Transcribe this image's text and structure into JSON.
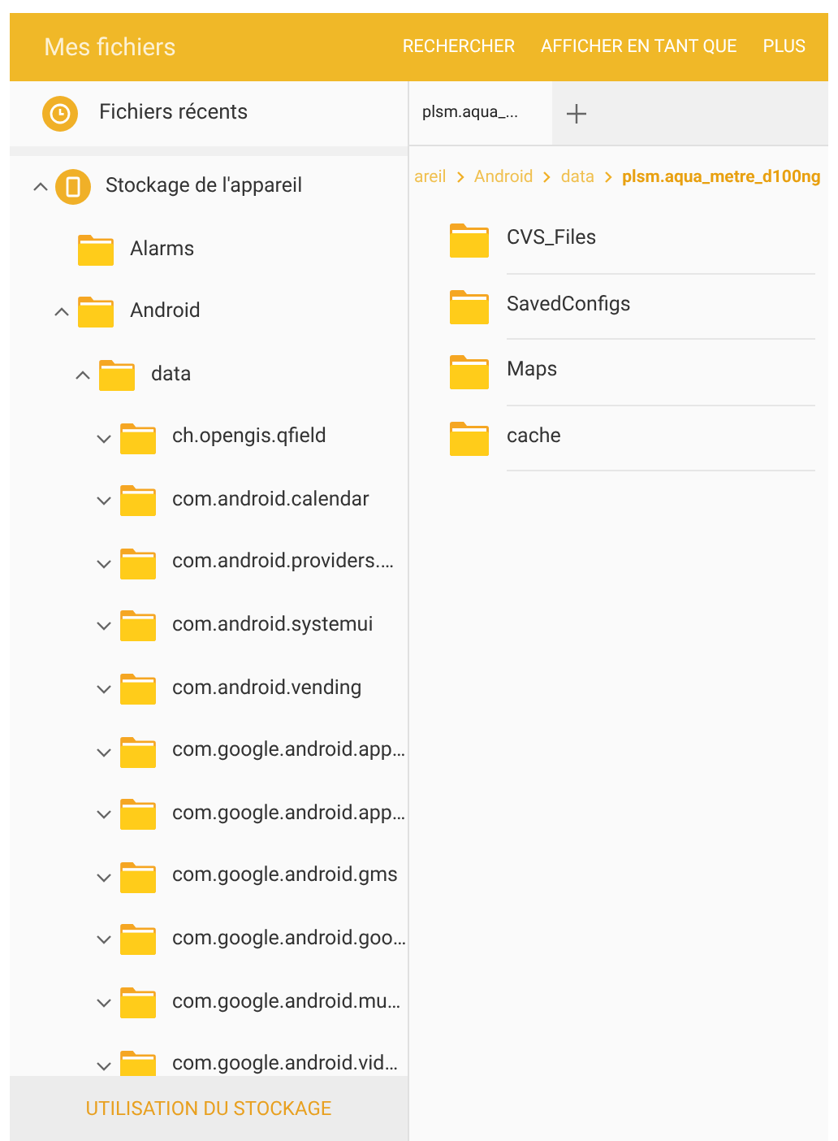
{
  "app_bar": {
    "title": "Mes fichiers",
    "actions": [
      "RECHERCHER",
      "AFFICHER EN TANT QUE",
      "PLUS"
    ]
  },
  "sidebar": {
    "recent": {
      "label": "Fichiers récents"
    },
    "tree": [
      {
        "label": "Stockage de l'appareil",
        "kind": "device",
        "expanded": true,
        "children": [
          {
            "label": "Alarms",
            "kind": "folder"
          },
          {
            "label": "Android",
            "kind": "folder",
            "expanded": true,
            "children": [
              {
                "label": "data",
                "kind": "folder",
                "expanded": true,
                "children": [
                  {
                    "label": "ch.opengis.qfield",
                    "kind": "folder",
                    "expanded": false
                  },
                  {
                    "label": "com.android.calendar",
                    "kind": "folder",
                    "expanded": false
                  },
                  {
                    "label": "com.android.providers.…",
                    "kind": "folder",
                    "expanded": false
                  },
                  {
                    "label": "com.android.systemui",
                    "kind": "folder",
                    "expanded": false
                  },
                  {
                    "label": "com.android.vending",
                    "kind": "folder",
                    "expanded": false
                  },
                  {
                    "label": "com.google.android.app…",
                    "kind": "folder",
                    "expanded": false
                  },
                  {
                    "label": "com.google.android.app…",
                    "kind": "folder",
                    "expanded": false
                  },
                  {
                    "label": "com.google.android.gms",
                    "kind": "folder",
                    "expanded": false
                  },
                  {
                    "label": "com.google.android.goo…",
                    "kind": "folder",
                    "expanded": false
                  },
                  {
                    "label": "com.google.android.mu…",
                    "kind": "folder",
                    "expanded": false
                  },
                  {
                    "label": "com.google.android.vid…",
                    "kind": "folder",
                    "expanded": false
                  }
                ]
              }
            ]
          }
        ]
      }
    ],
    "footer": "UTILISATION DU STOCKAGE"
  },
  "tabs": [
    {
      "label": "plsm.aqua_...",
      "selected": true
    }
  ],
  "breadcrumb": [
    "areil",
    "Android",
    "data",
    "plsm.aqua_metre_d100ng"
  ],
  "folders": [
    {
      "name": "CVS_Files"
    },
    {
      "name": "SavedConfigs"
    },
    {
      "name": "Maps"
    },
    {
      "name": "cache"
    }
  ]
}
